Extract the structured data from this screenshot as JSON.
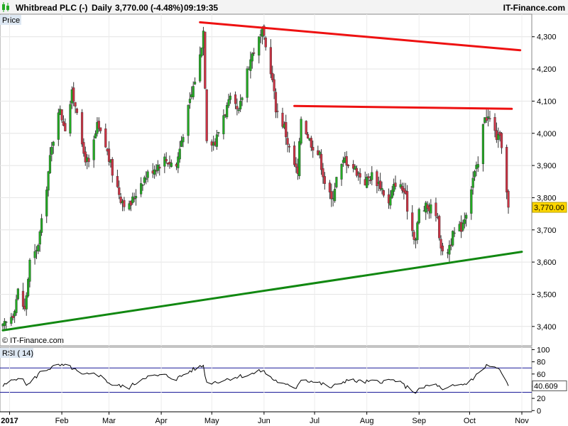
{
  "header": {
    "instrument": "Whitbread PLC (-)",
    "period": "Daily",
    "quote": "3,770.00 (-4.48%)",
    "time": "09:19:35",
    "brand": "IT-Finance.com"
  },
  "price_panel": {
    "label": "Price",
    "copyright": "© IT-Finance.com"
  },
  "rsi_panel": {
    "label": "RSI ( 14)"
  },
  "colors": {
    "up": "#22aa22",
    "down": "#cc3344",
    "resistance": "#ee1111",
    "support": "#118811",
    "rsi_line": "#000000",
    "rsi_band": "#1a1a99",
    "last_price_bg": "#ffd700"
  },
  "chart_data": [
    {
      "type": "candlestick",
      "title": "Whitbread PLC (-)",
      "ylabel": "Price",
      "ylim": [
        3340,
        4370
      ],
      "x_ticks": [
        "2017",
        "Feb",
        "Mar",
        "Apr",
        "May",
        "Jun",
        "Jul",
        "Aug",
        "Sep",
        "Oct",
        "Nov"
      ],
      "y_ticks": [
        "3,400",
        "3,500",
        "3,600",
        "3,700",
        "3,800",
        "3,900",
        "4,000",
        "4,100",
        "4,200",
        "4,300"
      ],
      "y_tick_values": [
        3400,
        3500,
        3600,
        3700,
        3800,
        3900,
        4000,
        4100,
        4200,
        4300
      ],
      "last_price": "3,770.00",
      "last_price_value": 3770,
      "grid": true,
      "anchors": [
        [
          "2016-12-28",
          3395
        ],
        [
          "2017-01-03",
          3440
        ],
        [
          "2017-01-06",
          3510
        ],
        [
          "2017-01-10",
          3450
        ],
        [
          "2017-01-13",
          3600
        ],
        [
          "2017-01-17",
          3630
        ],
        [
          "2017-01-20",
          3720
        ],
        [
          "2017-01-25",
          3920
        ],
        [
          "2017-01-30",
          4080
        ],
        [
          "2017-02-03",
          4020
        ],
        [
          "2017-02-07",
          4120
        ],
        [
          "2017-02-10",
          4080
        ],
        [
          "2017-02-13",
          3950
        ],
        [
          "2017-02-17",
          3900
        ],
        [
          "2017-02-22",
          4020
        ],
        [
          "2017-02-27",
          3960
        ],
        [
          "2017-03-03",
          3880
        ],
        [
          "2017-03-08",
          3800
        ],
        [
          "2017-03-13",
          3770
        ],
        [
          "2017-03-20",
          3850
        ],
        [
          "2017-03-27",
          3890
        ],
        [
          "2017-04-03",
          3920
        ],
        [
          "2017-04-10",
          3900
        ],
        [
          "2017-04-13",
          3980
        ],
        [
          "2017-04-19",
          4120
        ],
        [
          "2017-04-24",
          4240
        ],
        [
          "2017-04-26",
          4320
        ],
        [
          "2017-04-28",
          3990
        ],
        [
          "2017-05-03",
          3970
        ],
        [
          "2017-05-08",
          4060
        ],
        [
          "2017-05-12",
          4100
        ],
        [
          "2017-05-17",
          4060
        ],
        [
          "2017-05-22",
          4200
        ],
        [
          "2017-05-26",
          4260
        ],
        [
          "2017-05-31",
          4310
        ],
        [
          "2017-06-05",
          4200
        ],
        [
          "2017-06-08",
          4080
        ],
        [
          "2017-06-13",
          4020
        ],
        [
          "2017-06-16",
          3950
        ],
        [
          "2017-06-21",
          3870
        ],
        [
          "2017-06-23",
          4050
        ],
        [
          "2017-06-28",
          3980
        ],
        [
          "2017-07-04",
          3930
        ],
        [
          "2017-07-07",
          3850
        ],
        [
          "2017-07-11",
          3790
        ],
        [
          "2017-07-14",
          3860
        ],
        [
          "2017-07-19",
          3920
        ],
        [
          "2017-07-25",
          3890
        ],
        [
          "2017-07-31",
          3850
        ],
        [
          "2017-08-04",
          3870
        ],
        [
          "2017-08-09",
          3840
        ],
        [
          "2017-08-14",
          3780
        ],
        [
          "2017-08-18",
          3850
        ],
        [
          "2017-08-23",
          3820
        ],
        [
          "2017-08-28",
          3700
        ],
        [
          "2017-08-30",
          3670
        ],
        [
          "2017-09-01",
          3760
        ],
        [
          "2017-09-06",
          3770
        ],
        [
          "2017-09-11",
          3760
        ],
        [
          "2017-09-15",
          3620
        ],
        [
          "2017-09-18",
          3640
        ],
        [
          "2017-09-21",
          3680
        ],
        [
          "2017-09-26",
          3710
        ],
        [
          "2017-09-29",
          3760
        ],
        [
          "2017-10-03",
          3860
        ],
        [
          "2017-10-06",
          3900
        ],
        [
          "2017-10-10",
          4060
        ],
        [
          "2017-10-13",
          4040
        ],
        [
          "2017-10-17",
          3990
        ],
        [
          "2017-10-20",
          3970
        ],
        [
          "2017-10-23",
          3810
        ],
        [
          "2017-10-24",
          3770
        ]
      ],
      "trendlines": [
        {
          "role": "resistance",
          "from": [
            "2017-04-24",
            4345
          ],
          "to": [
            "2017-10-31",
            4258
          ]
        },
        {
          "role": "resistance",
          "from": [
            "2017-06-19",
            4085
          ],
          "to": [
            "2017-10-26",
            4076
          ]
        },
        {
          "role": "support",
          "from": [
            "2016-12-28",
            3388
          ],
          "to": [
            "2017-11-01",
            3632
          ]
        }
      ]
    },
    {
      "type": "line",
      "title": "RSI ( 14)",
      "ylim": [
        -2,
        104
      ],
      "y_ticks": [
        "100",
        "80",
        "60",
        "40",
        "20",
        "0"
      ],
      "y_tick_values": [
        100,
        80,
        60,
        40,
        20,
        0
      ],
      "bands": [
        70,
        30
      ],
      "last_value": "40.609",
      "last_value_num": 40.609,
      "anchors": [
        [
          "2016-12-28",
          40
        ],
        [
          "2017-01-06",
          55
        ],
        [
          "2017-01-12",
          42
        ],
        [
          "2017-01-20",
          65
        ],
        [
          "2017-01-30",
          74
        ],
        [
          "2017-02-06",
          72
        ],
        [
          "2017-02-13",
          58
        ],
        [
          "2017-02-22",
          60
        ],
        [
          "2017-03-03",
          42
        ],
        [
          "2017-03-13",
          38
        ],
        [
          "2017-03-22",
          55
        ],
        [
          "2017-04-03",
          58
        ],
        [
          "2017-04-10",
          52
        ],
        [
          "2017-04-19",
          66
        ],
        [
          "2017-04-26",
          74
        ],
        [
          "2017-04-28",
          45
        ],
        [
          "2017-05-05",
          48
        ],
        [
          "2017-05-15",
          55
        ],
        [
          "2017-05-25",
          60
        ],
        [
          "2017-05-31",
          66
        ],
        [
          "2017-06-06",
          52
        ],
        [
          "2017-06-13",
          42
        ],
        [
          "2017-06-20",
          38
        ],
        [
          "2017-06-23",
          52
        ],
        [
          "2017-07-04",
          45
        ],
        [
          "2017-07-11",
          38
        ],
        [
          "2017-07-20",
          50
        ],
        [
          "2017-07-31",
          47
        ],
        [
          "2017-08-09",
          48
        ],
        [
          "2017-08-18",
          50
        ],
        [
          "2017-08-25",
          38
        ],
        [
          "2017-08-30",
          30
        ],
        [
          "2017-09-05",
          40
        ],
        [
          "2017-09-12",
          42
        ],
        [
          "2017-09-15",
          32
        ],
        [
          "2017-09-21",
          40
        ],
        [
          "2017-09-29",
          44
        ],
        [
          "2017-10-06",
          60
        ],
        [
          "2017-10-11",
          74
        ],
        [
          "2017-10-17",
          70
        ],
        [
          "2017-10-20",
          62
        ],
        [
          "2017-10-24",
          40.609
        ]
      ]
    }
  ]
}
